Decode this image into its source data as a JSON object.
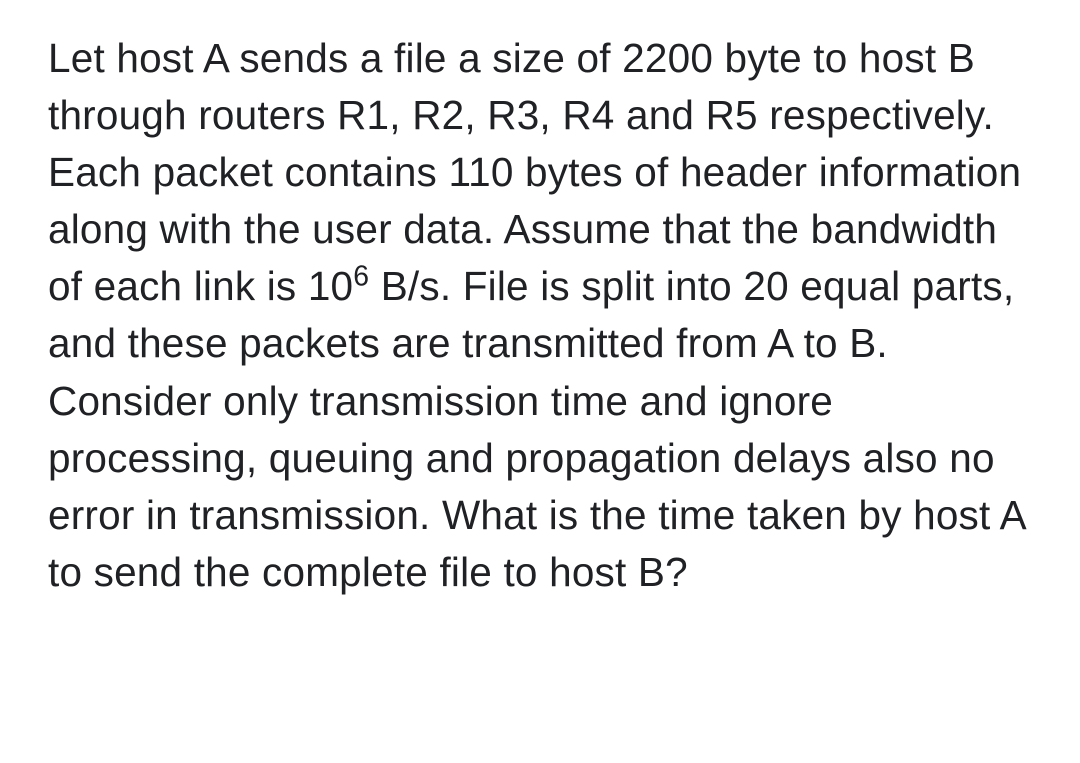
{
  "question": {
    "part1": "Let host A sends a file a size of 2200 byte to host B through routers R1, R2, R3, R4 and R5 respectively. Each packet contains 110 bytes of header information along with the user data. Assume that the bandwidth of each link is 10",
    "exponent": "6",
    "part2": " B/s. File is split into 20 equal parts, and these packets are transmitted from A to B. Consider only transmission time and ignore processing, queuing and propagation delays also no error in transmission. What is the time taken by host A to send the complete file to host B?"
  }
}
